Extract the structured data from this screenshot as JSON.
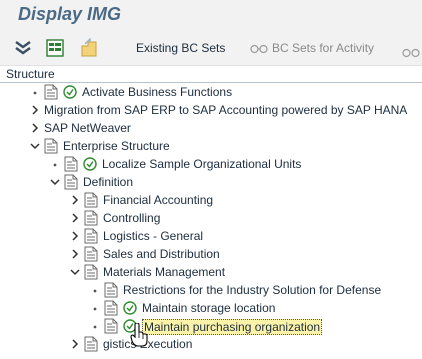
{
  "title": "Display IMG",
  "toolbar": {
    "icons": [
      "expand-all-icon",
      "where-used-icon",
      "info-icon"
    ],
    "existing_bc_sets": "Existing BC Sets",
    "bc_sets_for_activity": "BC Sets for Activity"
  },
  "structure_header": "Structure",
  "tree": {
    "rows": [
      {
        "label": "Activate Business Functions",
        "expander": "bullet",
        "doc": true,
        "clock": true
      },
      {
        "label": "Migration from SAP ERP to SAP Accounting powered by SAP HANA",
        "expander": "collapsed",
        "doc": false,
        "clock": false
      },
      {
        "label": "SAP NetWeaver",
        "expander": "collapsed",
        "doc": false,
        "clock": false
      },
      {
        "label": "Enterprise Structure",
        "expander": "expanded",
        "doc": true,
        "clock": false
      },
      {
        "label": "Localize Sample Organizational Units",
        "expander": "bullet",
        "doc": true,
        "clock": true
      },
      {
        "label": "Definition",
        "expander": "expanded",
        "doc": true,
        "clock": false
      },
      {
        "label": "Financial Accounting",
        "expander": "collapsed",
        "doc": true,
        "clock": false
      },
      {
        "label": "Controlling",
        "expander": "collapsed",
        "doc": true,
        "clock": false
      },
      {
        "label": "Logistics - General",
        "expander": "collapsed",
        "doc": true,
        "clock": false
      },
      {
        "label": "Sales and Distribution",
        "expander": "collapsed",
        "doc": true,
        "clock": false
      },
      {
        "label": "Materials Management",
        "expander": "expanded",
        "doc": true,
        "clock": false
      },
      {
        "label": "Restrictions for the Industry Solution for Defense",
        "expander": "bullet",
        "doc": true,
        "clock": false
      },
      {
        "label": "Maintain storage location",
        "expander": "bullet",
        "doc": true,
        "clock": true
      },
      {
        "label": "Maintain purchasing organization",
        "expander": "bullet",
        "doc": true,
        "clock": true,
        "highlight": true
      },
      {
        "label": "gistics Execution",
        "expander": "collapsed",
        "doc": true,
        "clock": false
      }
    ]
  },
  "colors": {
    "title": "#4a6a86",
    "highlight": "#fbf3a9",
    "clock_green": "#2e8b2e"
  }
}
